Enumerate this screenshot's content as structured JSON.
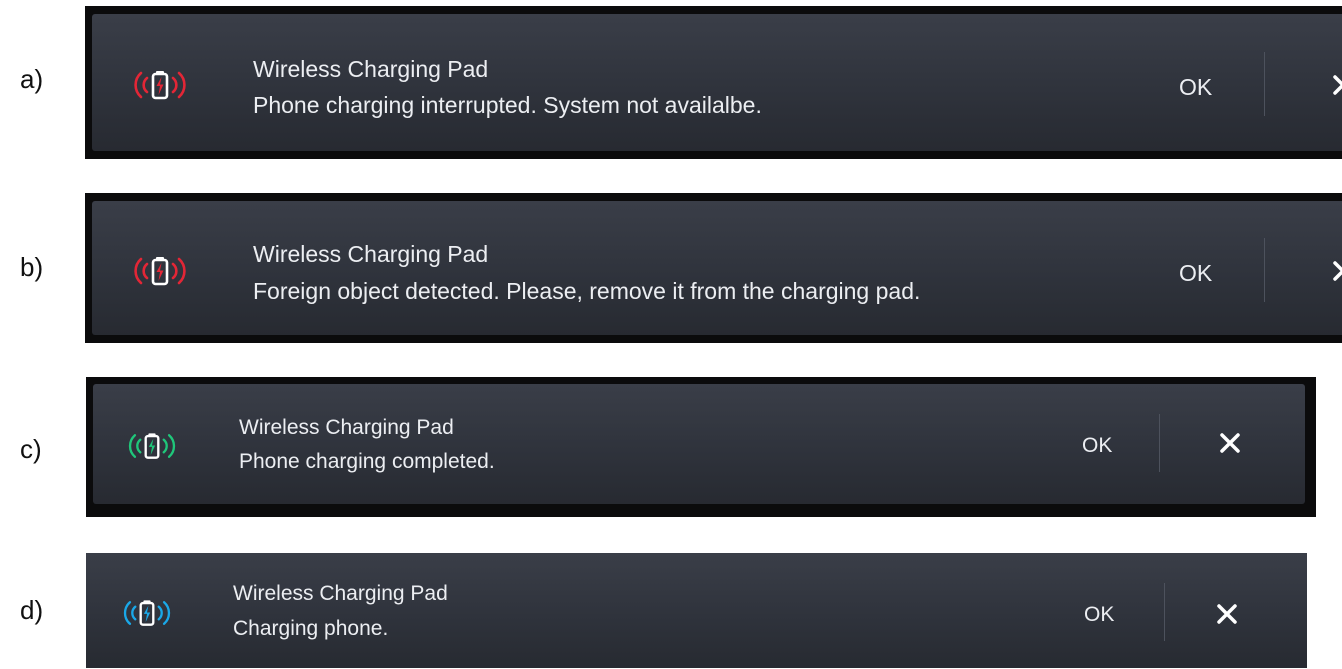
{
  "notifications": [
    {
      "letter": "a)",
      "title": "Wireless Charging Pad",
      "message": "Phone charging interrupted. System not availalbe.",
      "ok_label": "OK",
      "status": "error",
      "icon": "wireless-charging-icon",
      "icon_color": "#e32636"
    },
    {
      "letter": "b)",
      "title": "Wireless Charging Pad",
      "message": "Foreign object  detected. Please, remove it from the charging pad.",
      "ok_label": "OK",
      "status": "error",
      "icon": "wireless-charging-icon",
      "icon_color": "#e32636"
    },
    {
      "letter": "c)",
      "title": "Wireless Charging Pad",
      "message": "Phone charging completed.",
      "ok_label": "OK",
      "status": "completed",
      "icon": "wireless-charging-icon",
      "icon_color": "#1fc77a"
    },
    {
      "letter": "d)",
      "title": "Wireless Charging Pad",
      "message": "Charging phone.",
      "ok_label": "OK",
      "status": "charging",
      "icon": "wireless-charging-icon",
      "icon_color": "#1aa8e8"
    }
  ],
  "colors": {
    "text": "#eceef2",
    "card_background": "#2f333c",
    "divider": "#4d525d"
  }
}
